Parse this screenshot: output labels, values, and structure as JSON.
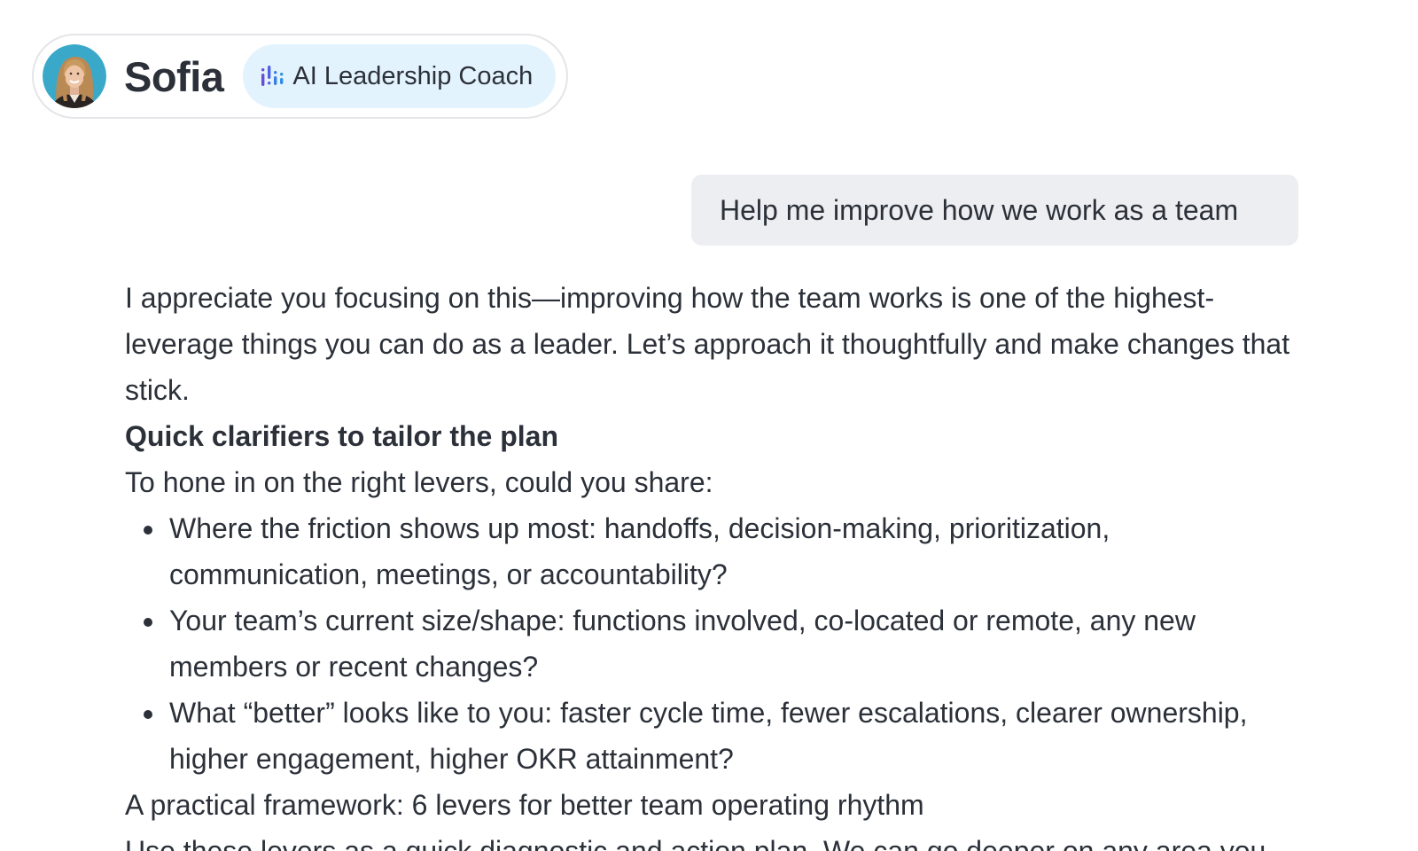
{
  "agent": {
    "name": "Sofia",
    "role": "AI Leadership Coach",
    "colors": {
      "badge_bg": "#e3f3fd",
      "icon_purple": "#6a4bd6",
      "icon_blue": "#2f8ee6"
    }
  },
  "user_message": {
    "text": "Help me improve how we work as a team"
  },
  "assistant_message": {
    "intro": "I appreciate you focusing on this—improving how the team works is one of the highest-leverage things you can do as a leader. Let’s approach it thoughtfully and make changes that stick.",
    "heading": "Quick clarifiers to tailor the plan",
    "lead_in": "To hone in on the right levers, could you share:",
    "bullets": [
      "Where the friction shows up most: handoffs, decision-making, prioritization, communication, meetings, or accountability?",
      "Your team’s current size/shape: functions involved, co-located or remote, any new members or recent changes?",
      "What “better” looks like to you: faster cycle time, fewer escalations, clearer ownership, higher engagement, higher OKR attainment?"
    ],
    "framework_title": "A practical framework: 6 levers for better team operating rhythm",
    "framework_lead": "Use these levers as a quick diagnostic and action plan. We can go deeper on any area you"
  },
  "icons": {
    "avatar": "avatar-photo",
    "role": "ai-sound-bars-icon"
  }
}
